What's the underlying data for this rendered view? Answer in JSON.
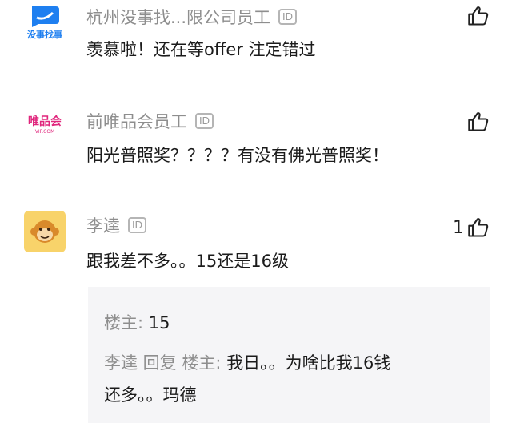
{
  "comments": [
    {
      "name": "杭州没事找...限公司员工",
      "badge": "ID",
      "text": "羡慕啦！还在等offer 注定错过",
      "likes": "",
      "avatar_text": "没事找事"
    },
    {
      "name": "前唯品会员工",
      "badge": "ID",
      "text": "阳光普照奖？？？？有没有佛光普照奖！",
      "likes": "",
      "avatar_text": "唯品会",
      "avatar_subtext": "VIP.COM"
    },
    {
      "name": "李逵",
      "badge": "ID",
      "text": "跟我差不多。。15还是16级",
      "likes": "1"
    }
  ],
  "reply": {
    "line1_author": "楼主:",
    "line1_text": " 15",
    "line2_author": "李逵 回复 楼主:",
    "line2_text": " 我日。。为啥比我16钱",
    "line3_text": "还多。。玛德"
  },
  "colors": {
    "name": "#8e8e8e",
    "text": "#1b1b1b",
    "reply_bg": "#f5f5f7",
    "logo_blue": "#1e7ff0",
    "logo_pink": "#e0257c",
    "avatar_yellow": "#f8d36a"
  },
  "icons": [
    "thumbs-up-icon",
    "id-badge-icon"
  ]
}
